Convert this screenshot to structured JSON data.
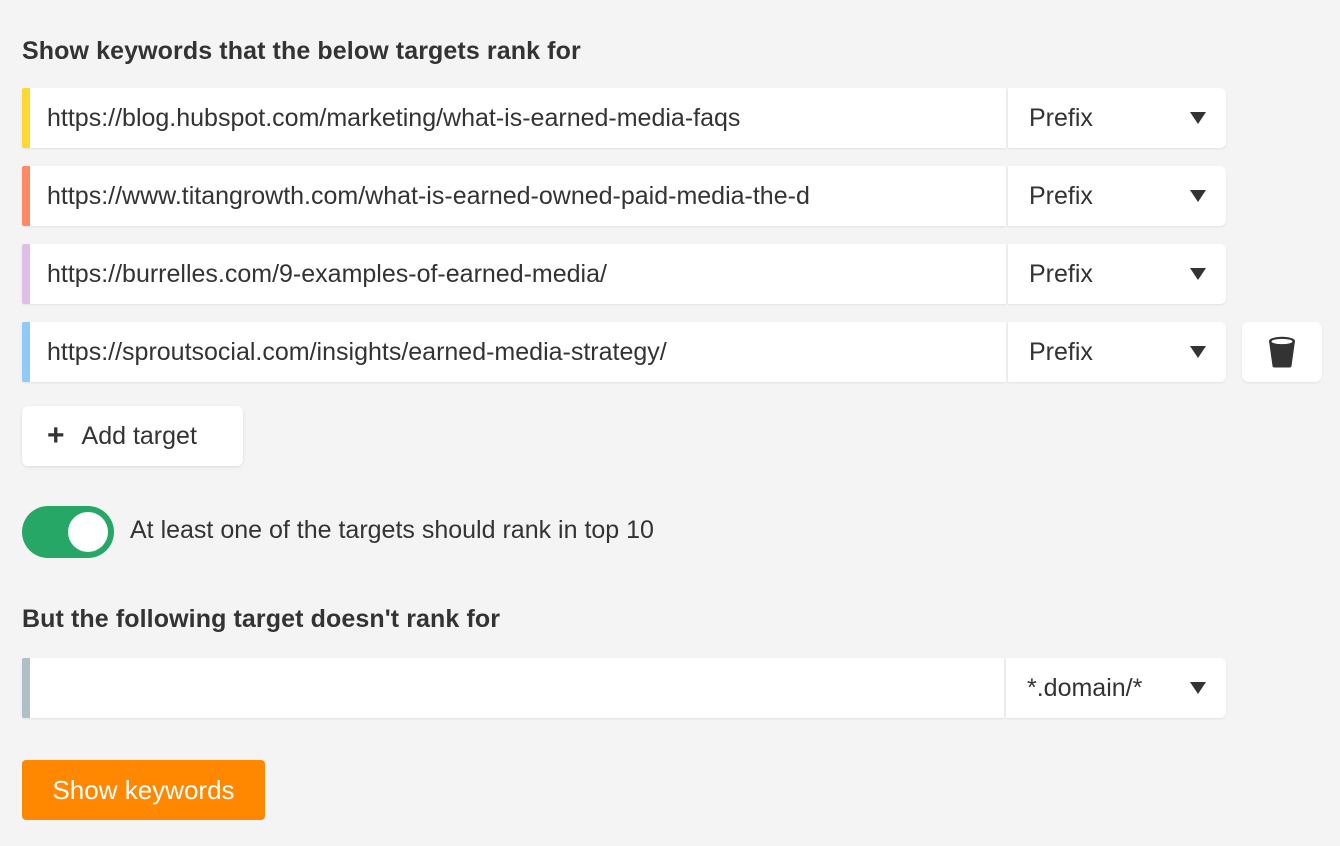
{
  "include_section": {
    "heading": "Show keywords that the below targets rank for",
    "targets": [
      {
        "url": "https://blog.hubspot.com/marketing/what-is-earned-media-faqs",
        "mode": "Prefix",
        "color": "#fdd835"
      },
      {
        "url": "https://www.titangrowth.com/what-is-earned-owned-paid-media-the-d",
        "mode": "Prefix",
        "color": "#ff8a65"
      },
      {
        "url": "https://burrelles.com/9-examples-of-earned-media/",
        "mode": "Prefix",
        "color": "#e1bee7"
      },
      {
        "url": "https://sproutsocial.com/insights/earned-media-strategy/",
        "mode": "Prefix",
        "color": "#90caf9"
      }
    ],
    "delete_icon": "trash-icon",
    "add_target": {
      "icon": "plus-icon",
      "label": "Add target"
    }
  },
  "toggle": {
    "on": true,
    "label": "At least one of the targets should rank in top 10",
    "color": "#27a765"
  },
  "exclude_section": {
    "heading": "But the following target doesn't rank for",
    "target": {
      "url": "",
      "placeholder": "",
      "mode": "*.domain/*",
      "color": "#b0bec5"
    }
  },
  "submit": {
    "label": "Show keywords",
    "color": "#ff8800"
  }
}
